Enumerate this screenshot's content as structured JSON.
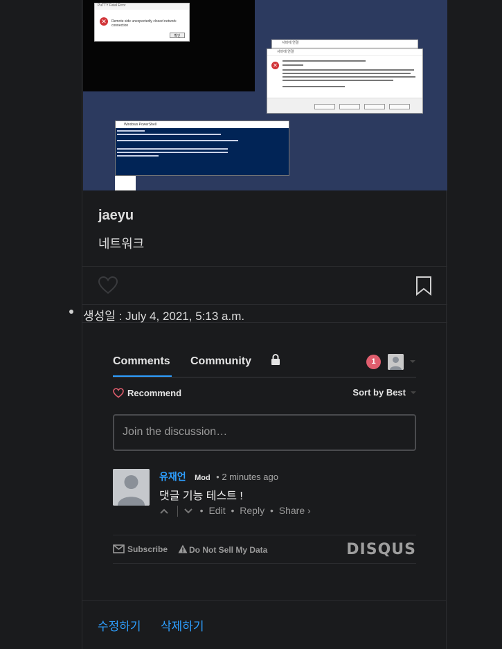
{
  "post": {
    "author": "jaeyu",
    "subtitle": "네트워크",
    "created_label": "생성일",
    "created_value": " : July 4, 2021, 5:13 a.m.",
    "image": {
      "dialog1_msg": "Remote side unexpectedly closed network connection",
      "dialog1_title": "PuTTY Fatal Error",
      "dialog1_ok": "확인",
      "powershell_title": "Windows PowerShell"
    }
  },
  "disqus": {
    "tabs": [
      "Comments",
      "Community"
    ],
    "notification_count": "1",
    "recommend_label": "Recommend",
    "sort_label": "Sort by Best",
    "input_placeholder": "Join the discussion…",
    "comments": [
      {
        "author": "유재언",
        "badge": "Mod",
        "time": "• 2 minutes ago",
        "body": "댓글 기능 테스트 !",
        "actions": [
          "Edit",
          "Reply",
          "Share ›"
        ]
      }
    ],
    "footer": {
      "subscribe": "Subscribe",
      "do_not_sell": "Do Not Sell My Data",
      "logo": "DISQUS"
    }
  },
  "bottom_actions": {
    "edit": "수정하기",
    "delete": "삭제하기"
  },
  "colors": {
    "background": "#1a1b1d",
    "accent": "#2e9fff",
    "notification": "#e05e6e"
  }
}
